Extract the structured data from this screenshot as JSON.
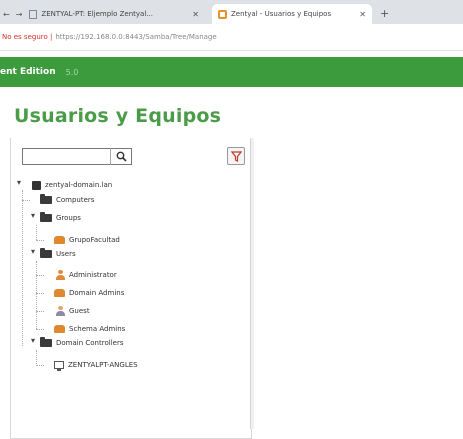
{
  "browser": {
    "tab1_label": "ZENTYAL-PT: Eljemplo Zentyal...",
    "tab2_label": "Zentyal - Usuarios y Equipos",
    "address": "https://192.168.0.0:8443/Samba/Tree/Manage",
    "address_prefix": "No es seguro |"
  },
  "topbar": {
    "brand": "ent Edition",
    "version": "5.0"
  },
  "page": {
    "title": "Usuarios y Equipos"
  },
  "tree": {
    "search_placeholder": "",
    "root": "zentyal-domain.lan",
    "computers": "Computers",
    "groups": "Groups",
    "group_items": [
      "GrupoFacultad"
    ],
    "users": "Users",
    "user_items": [
      "Administrator",
      "Domain Admins",
      "Guest",
      "Schema Admins"
    ],
    "dc": "Domain Controllers",
    "dc_items": [
      "ZENTYALPT-ANGLES"
    ]
  },
  "colors": {
    "brand_green": "#3c9b3c",
    "title_green": "#4b9c49",
    "icon_orange": "#e0882e"
  }
}
